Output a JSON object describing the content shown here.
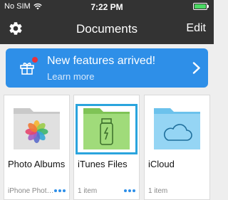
{
  "status_bar": {
    "carrier": "No SIM",
    "time": "7:22 PM",
    "battery_level": 1.0
  },
  "navbar": {
    "title": "Documents",
    "edit_label": "Edit"
  },
  "banner": {
    "title": "New features arrived!",
    "link": "Learn more"
  },
  "folders": [
    {
      "name": "Photo Albums",
      "detail": "iPhone Phot…"
    },
    {
      "name": "iTunes Files",
      "detail": "1 item"
    },
    {
      "name": "iCloud",
      "detail": "1 item"
    }
  ],
  "colors": {
    "navbar_bg": "#333333",
    "accent": "#2e8fe8",
    "badge": "#e8323c",
    "selection": "#2aa4dd",
    "folder_gray": "#d9d9d9",
    "folder_green": "#93d46a",
    "folder_blue": "#8ed1f1"
  },
  "icons": {
    "settings": "gear-icon",
    "banner": "gift-icon",
    "banner_arrow": "chevron-right-icon",
    "photos": "photos-flower-icon",
    "itunes": "usb-drive-icon",
    "icloud": "cloud-icon",
    "more": "more-dots-icon"
  }
}
